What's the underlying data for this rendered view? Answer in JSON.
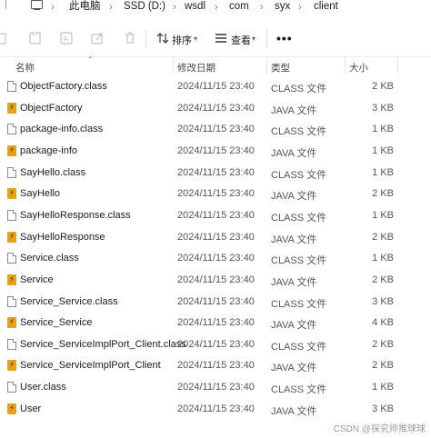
{
  "address_bar": {
    "crumbs": [
      "此电脑",
      "SSD (D:)",
      "wsdl",
      "com",
      "syx",
      "client"
    ]
  },
  "toolbar": {
    "sort_label": "排序",
    "view_label": "查看",
    "more_label": "•••"
  },
  "columns": {
    "name": "名称",
    "modified": "修改日期",
    "type": "类型",
    "size": "大小"
  },
  "files": [
    {
      "name": "ObjectFactory.class",
      "date": "2024/11/15 23:40",
      "type": "CLASS 文件",
      "size": "2 KB",
      "icon": "class-file-icon"
    },
    {
      "name": "ObjectFactory",
      "date": "2024/11/15 23:40",
      "type": "JAVA 文件",
      "size": "3 KB",
      "icon": "java-file-icon"
    },
    {
      "name": "package-info.class",
      "date": "2024/11/15 23:40",
      "type": "CLASS 文件",
      "size": "1 KB",
      "icon": "class-file-icon"
    },
    {
      "name": "package-info",
      "date": "2024/11/15 23:40",
      "type": "JAVA 文件",
      "size": "1 KB",
      "icon": "java-file-icon"
    },
    {
      "name": "SayHello.class",
      "date": "2024/11/15 23:40",
      "type": "CLASS 文件",
      "size": "1 KB",
      "icon": "class-file-icon"
    },
    {
      "name": "SayHello",
      "date": "2024/11/15 23:40",
      "type": "JAVA 文件",
      "size": "2 KB",
      "icon": "java-file-icon"
    },
    {
      "name": "SayHelloResponse.class",
      "date": "2024/11/15 23:40",
      "type": "CLASS 文件",
      "size": "1 KB",
      "icon": "class-file-icon"
    },
    {
      "name": "SayHelloResponse",
      "date": "2024/11/15 23:40",
      "type": "JAVA 文件",
      "size": "2 KB",
      "icon": "java-file-icon"
    },
    {
      "name": "Service.class",
      "date": "2024/11/15 23:40",
      "type": "CLASS 文件",
      "size": "1 KB",
      "icon": "class-file-icon"
    },
    {
      "name": "Service",
      "date": "2024/11/15 23:40",
      "type": "JAVA 文件",
      "size": "2 KB",
      "icon": "java-file-icon"
    },
    {
      "name": "Service_Service.class",
      "date": "2024/11/15 23:40",
      "type": "CLASS 文件",
      "size": "3 KB",
      "icon": "class-file-icon"
    },
    {
      "name": "Service_Service",
      "date": "2024/11/15 23:40",
      "type": "JAVA 文件",
      "size": "4 KB",
      "icon": "java-file-icon"
    },
    {
      "name": "Service_ServiceImplPort_Client.class",
      "date": "2024/11/15 23:40",
      "type": "CLASS 文件",
      "size": "2 KB",
      "icon": "class-file-icon"
    },
    {
      "name": "Service_ServiceImplPort_Client",
      "date": "2024/11/15 23:40",
      "type": "JAVA 文件",
      "size": "2 KB",
      "icon": "java-file-icon"
    },
    {
      "name": "User.class",
      "date": "2024/11/15 23:40",
      "type": "CLASS 文件",
      "size": "1 KB",
      "icon": "class-file-icon"
    },
    {
      "name": "User",
      "date": "2024/11/15 23:40",
      "type": "JAVA 文件",
      "size": "3 KB",
      "icon": "java-file-icon"
    }
  ],
  "watermark": "CSDN @探究师推球球"
}
